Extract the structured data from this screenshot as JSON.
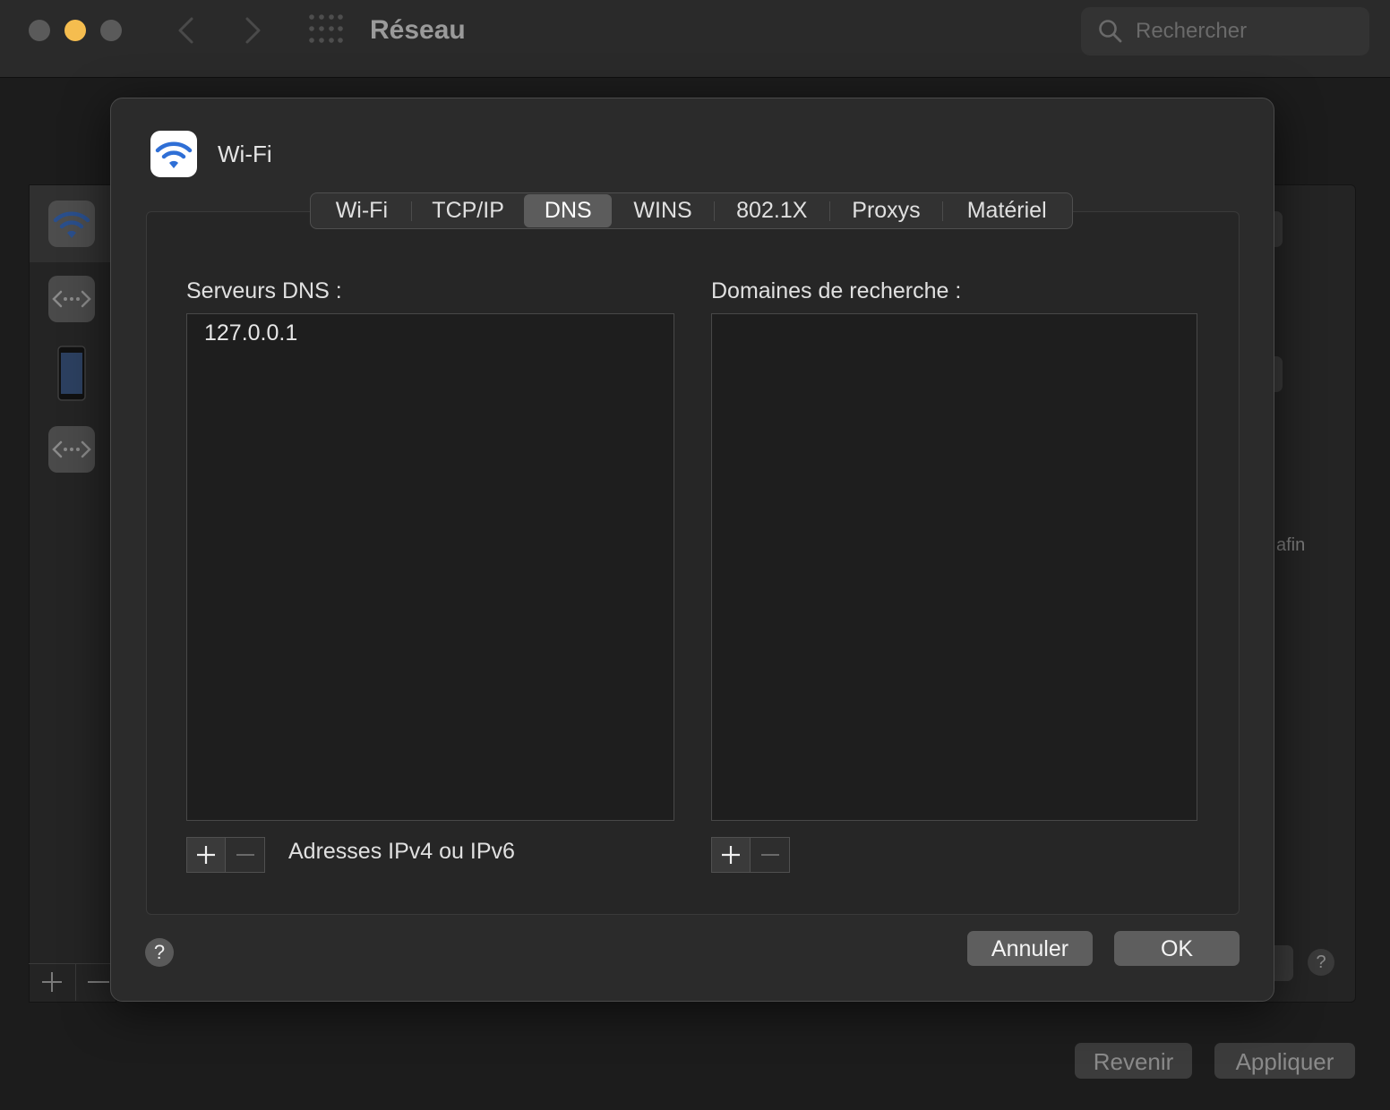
{
  "window": {
    "title": "Réseau",
    "search_placeholder": "Rechercher"
  },
  "background": {
    "partial_text": "afin",
    "revert_label": "Revenir",
    "apply_label": "Appliquer",
    "help_label": "?"
  },
  "sheet": {
    "title": "Wi-Fi",
    "tabs": [
      {
        "label": "Wi-Fi"
      },
      {
        "label": "TCP/IP"
      },
      {
        "label": "DNS"
      },
      {
        "label": "WINS"
      },
      {
        "label": "802.1X"
      },
      {
        "label": "Proxys"
      },
      {
        "label": "Matériel"
      }
    ],
    "active_tab": "DNS",
    "dns": {
      "servers_label": "Serveurs DNS :",
      "servers": [
        "127.0.0.1"
      ],
      "hint": "Adresses IPv4 ou IPv6",
      "domains_label": "Domaines de recherche :",
      "domains": []
    },
    "help_label": "?",
    "cancel_label": "Annuler",
    "ok_label": "OK"
  },
  "colors": {
    "wifi_blue": "#2f6fd6",
    "close": "#5a5a5a",
    "minimize": "#f5bd4f",
    "zoom": "#5a5a5a"
  }
}
